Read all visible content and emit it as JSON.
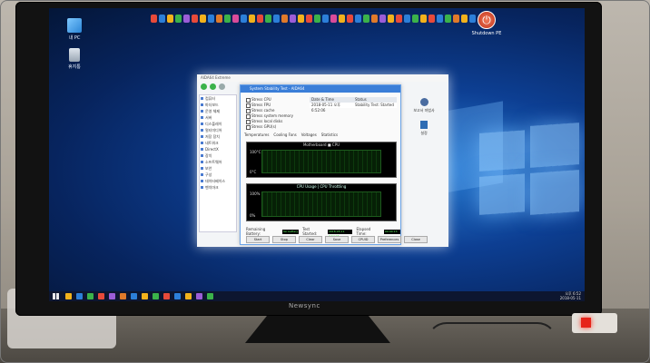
{
  "desktop": {
    "icons": [
      {
        "label": "내 PC",
        "icon": "computer-icon"
      },
      {
        "label": "휴지통",
        "icon": "recycle-bin-icon"
      }
    ],
    "shutdown_label": "Shutdown PE",
    "launcher_colors": [
      "#e84a3a",
      "#2c7fd9",
      "#f2b21c",
      "#3bb24a",
      "#9b5dd8",
      "#e84a3a",
      "#f2b21c",
      "#2c7fd9",
      "#e07a2a",
      "#3bb24a",
      "#d94b9a",
      "#2c7fd9",
      "#f2b21c",
      "#e84a3a",
      "#3bb24a",
      "#2c7fd9",
      "#e07a2a",
      "#9b5dd8",
      "#f2b21c",
      "#e84a3a",
      "#3bb24a",
      "#2c7fd9",
      "#d94b9a",
      "#f2b21c",
      "#e84a3a",
      "#2c7fd9",
      "#3bb24a",
      "#e07a2a",
      "#9b5dd8",
      "#f2b21c",
      "#e84a3a",
      "#2c7fd9",
      "#3bb24a",
      "#f2b21c",
      "#e84a3a",
      "#2c7fd9",
      "#3bb24a",
      "#e07a2a",
      "#f2b21c",
      "#2c7fd9"
    ]
  },
  "app": {
    "title": "AIDA64 Extreme",
    "tree_items": [
      "컴퓨터",
      "마더보드",
      "운영 체제",
      "서버",
      "디스플레이",
      "멀티미디어",
      "저장 장치",
      "네트워크",
      "DirectX",
      "장치",
      "소프트웨어",
      "보안",
      "구성",
      "데이터베이스",
      "벤치마크"
    ],
    "right_panel": {
      "report_label": "보고서 마법사",
      "settings_label": "설정"
    }
  },
  "dialog": {
    "title": "System Stability Test - AIDA64",
    "checks": [
      "Stress CPU",
      "Stress FPU",
      "Stress cache",
      "Stress system memory",
      "Stress local disks",
      "Stress GPU(s)"
    ],
    "info_headers": [
      "Date & Time",
      "Status"
    ],
    "info_row": [
      "2018-05-11 오후 6:52:06",
      "Stability Test: Started"
    ],
    "tabs": [
      "Temperatures",
      "Cooling Fans",
      "Voltages",
      "Statistics"
    ],
    "graph1_title": "Motherboard  ■ CPU",
    "graph1_ymax": "100°C",
    "graph1_ymin": "0°C",
    "graph2_title": "CPU Usage | CPU Throttling",
    "graph2_ymax": "100%",
    "graph2_ymin": "0%",
    "remaining_label": "Remaining Battery:",
    "remaining_value": "No battery",
    "test_started_label": "Test Started:",
    "test_started_value": "2018-05-11 6:52:06",
    "elapsed_label": "Elapsed Time:",
    "elapsed_value": "00:00:13",
    "buttons": [
      "Start",
      "Stop",
      "Clear",
      "Save",
      "CPUID",
      "Preferences",
      "Close"
    ]
  },
  "monitor": {
    "brand": "Newsync"
  },
  "taskbar": {
    "time": "오후 6:52",
    "date": "2018-05-11",
    "icon_colors": [
      "#f2b21c",
      "#2c7fd9",
      "#3bb24a",
      "#e84a3a",
      "#9b5dd8",
      "#e07a2a",
      "#2c7fd9",
      "#f2b21c",
      "#3bb24a",
      "#e84a3a",
      "#2c7fd9",
      "#f2b21c",
      "#9b5dd8",
      "#3bb24a"
    ]
  }
}
